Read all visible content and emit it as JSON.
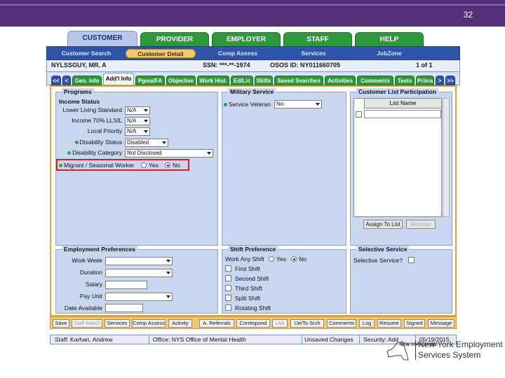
{
  "slide_number": "32",
  "main_tabs": [
    "CUSTOMER",
    "PROVIDER",
    "EMPLOYER",
    "STAFF",
    "HELP"
  ],
  "sub_nav": [
    "Customer Search",
    "Customer Detail",
    "Comp Assess",
    "Services",
    "JobZone"
  ],
  "customer": {
    "name": "NYLSSGUY, MR. A",
    "ssn": "SSN: ***-**-1974",
    "osos_id": "OSOS ID: NY011660705",
    "page": "1 of 1"
  },
  "detail_tabs": [
    "<<",
    "<",
    "Gen. Info",
    "Add'l Info",
    "Pgms/FA",
    "Objective",
    "Work Hist.",
    "Ed/Lic",
    "Skills",
    "Saved Searches",
    "Activities",
    "Comments",
    "Tests",
    "Prima",
    ">",
    ">>"
  ],
  "programs": {
    "title": "Programs",
    "income_status": "Income Status",
    "lower_living_label": "Lower Living Standard",
    "lower_living_value": "N/A",
    "income70_label": "Income 70% LLSIL",
    "income70_value": "N/A",
    "local_priority_label": "Local Priority",
    "local_priority_value": "N/A",
    "disability_status_label": "Disability Status",
    "disability_status_value": "Disabled",
    "disability_category_label": "Disability Category",
    "disability_category_value": "Not Disclosed",
    "msw_label": "Migrant / Seasonal Worker",
    "yes": "Yes",
    "no": "No"
  },
  "military": {
    "title": "Military Service",
    "veteran_label": "Service Veteran",
    "veteran_value": "No"
  },
  "customer_list": {
    "title": "Customer List Participation",
    "column": "List Name",
    "assign_button": "Assign To List",
    "remove_button": "Remove"
  },
  "employment": {
    "title": "Employment Preferences",
    "work_week": "Work Week",
    "duration": "Duration",
    "salary": "Salary",
    "pay_unit": "Pay Unit",
    "date_available": "Date Available"
  },
  "shift": {
    "title": "Shift Preference",
    "work_any_shift": "Work Any Shift",
    "yes": "Yes",
    "no": "No",
    "first": "First Shift",
    "second": "Second Shift",
    "third": "Third Shift",
    "split": "Split Shift",
    "rotating": "Rotating Shift"
  },
  "selective": {
    "title": "Selective Service",
    "label": "Selective Service?"
  },
  "bottom_buttons": [
    "Save",
    "Staff Match",
    "Services",
    "Comp Assess",
    "Activity",
    "A. Referrals",
    "Correspond",
    "LMI",
    "Ue/To Srch",
    "Comments",
    "Log",
    "Resume",
    "Signed",
    "Message"
  ],
  "status": {
    "staff": "Staff: Karhan, Andrew",
    "office": "Office: NYS Office of Mental Health",
    "unsaved": "Unsaved Changes",
    "security": "Security: Add",
    "date": "05/19/2015"
  },
  "logo": {
    "state_text": "NEW YORK STATE",
    "line1": "New York Employment",
    "line2": "Services System"
  },
  "colors": {
    "header_purple": "#553278",
    "tab_green": "#2a9a3a",
    "nav_blue": "#2e55a8",
    "panel_blue": "#c8d6f0",
    "highlight_orange": "#f0a23a",
    "callout_red": "#e01b24"
  }
}
